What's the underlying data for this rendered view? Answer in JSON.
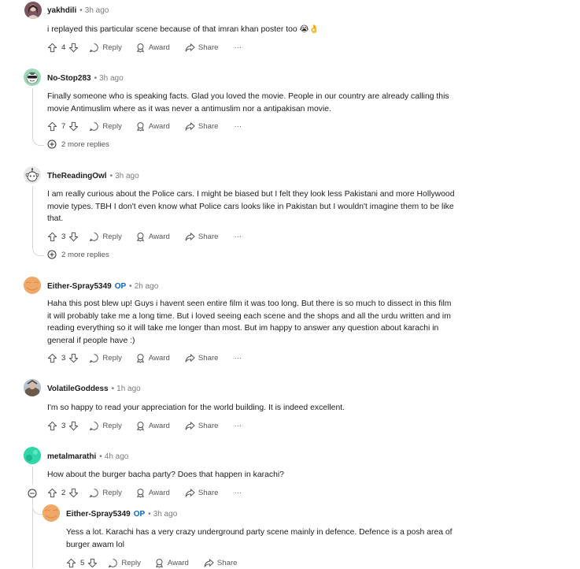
{
  "comments": [
    {
      "user": "yakhdili",
      "time": "3h ago",
      "text": "i replayed this particular scene because of that imran khan poster too 😭👌",
      "votes": "4",
      "avatar_color": "#7a5560",
      "reply_label": "Reply",
      "award_label": "Award",
      "share_label": "Share",
      "more_label": "···"
    },
    {
      "user": "No-Stop283",
      "time": "3h ago",
      "text": "Finally someone who is speaking facts. Glad you loved the movie. People in our country are already calling this movie Antimuslim where as it was never a antimuslim nor a antipakisan movie.",
      "votes": "7",
      "avatar_color": "#9ad9b5",
      "reply_label": "Reply",
      "award_label": "Award",
      "share_label": "Share",
      "more_label": "···",
      "more_replies": "2 more replies"
    },
    {
      "user": "TheReadingOwl",
      "time": "3h ago",
      "text": "I am really curious about the Police cars. I might be biased but I felt they look less Pakistani and more Hollywood movie types. TBH I don't even know what Police cars looks like in Pakistan but I wouldn't imagine them to be like that.",
      "votes": "3",
      "avatar_color": "#e8e8e8",
      "reply_label": "Reply",
      "award_label": "Award",
      "share_label": "Share",
      "more_label": "···",
      "more_replies": "2 more replies"
    },
    {
      "user": "Either-Spray5349",
      "op_badge": "OP",
      "time": "2h ago",
      "text": "Haha this post blew up! Guys i havent seen entire film it was too long. But there is so much to dissect in this film it will probably take me a long time. But i loved seeing each scene and the shops and all the urdu written and im reading everything so it will take me longer than most. But im happy to answer any question about karachi in general if people have :)",
      "votes": "3",
      "avatar_color": "#f0a868",
      "reply_label": "Reply",
      "award_label": "Award",
      "share_label": "Share",
      "more_label": "···"
    },
    {
      "user": "VolatileGoddess",
      "time": "1h ago",
      "text": "I'm so happy to read your appreciation for the world building. It is indeed excellent.",
      "votes": "3",
      "avatar_color": "#8a9aa8",
      "reply_label": "Reply",
      "award_label": "Award",
      "share_label": "Share",
      "more_label": "···"
    },
    {
      "user": "metalmarathi",
      "time": "4h ago",
      "text": "How about the burger bacha party? Does that happen in karachi?",
      "votes": "2",
      "avatar_color": "#2fd6a8",
      "reply_label": "Reply",
      "award_label": "Award",
      "share_label": "Share",
      "more_label": "···"
    },
    {
      "user": "Either-Spray5349",
      "op_badge": "OP",
      "time": "3h ago",
      "text": "Yess a lot. Karachi has a very crazy underground party scene mainly in defence. Defence is a posh area of burger awam lol",
      "votes": "5",
      "avatar_color": "#f0a868",
      "reply_label": "Reply",
      "award_label": "Award",
      "share_label": "Share"
    }
  ],
  "meta_sep": "•"
}
